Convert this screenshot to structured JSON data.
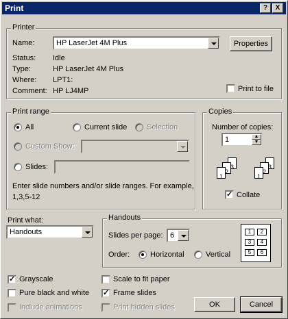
{
  "window": {
    "title": "Print",
    "help_btn": "?",
    "close_btn": "X"
  },
  "printer": {
    "legend": "Printer",
    "name_label": "Name:",
    "name_value": "HP LaserJet 4M Plus",
    "properties_btn": "Properties",
    "status_label": "Status:",
    "status_value": "Idle",
    "type_label": "Type:",
    "type_value": "HP LaserJet 4M Plus",
    "where_label": "Where:",
    "where_value": "LPT1:",
    "comment_label": "Comment:",
    "comment_value": "HP LJ4MP",
    "print_to_file": "Print to file",
    "print_to_file_checked": false
  },
  "print_range": {
    "legend": "Print range",
    "all": "All",
    "current_slide": "Current slide",
    "selection": "Selection",
    "custom_show": "Custom Show:",
    "slides": "Slides:",
    "hint": "Enter slide numbers and/or slide ranges. For example,",
    "hint_example": "1,3,5-12",
    "selected": "all"
  },
  "copies": {
    "legend": "Copies",
    "number_label": "Number of copies:",
    "number_value": "1",
    "collate": "Collate",
    "collate_checked": true,
    "page_numbers": [
      "1",
      "2",
      "3"
    ]
  },
  "print_what": {
    "label": "Print what:",
    "value": "Handouts"
  },
  "handouts": {
    "legend": "Handouts",
    "slides_per_page_label": "Slides per page:",
    "slides_per_page_value": "6",
    "order_label": "Order:",
    "horizontal": "Horizontal",
    "vertical": "Vertical",
    "order_selected": "horizontal",
    "preview_cells": [
      "1",
      "2",
      "3",
      "4",
      "5",
      "6"
    ]
  },
  "options": {
    "grayscale": "Grayscale",
    "grayscale_checked": true,
    "pure_bw": "Pure black and white",
    "pure_bw_checked": false,
    "include_animations": "Include animations",
    "scale_to_fit": "Scale to fit paper",
    "scale_to_fit_checked": false,
    "frame_slides": "Frame slides",
    "frame_slides_checked": true,
    "print_hidden": "Print hidden slides"
  },
  "buttons": {
    "ok": "OK",
    "cancel": "Cancel"
  }
}
